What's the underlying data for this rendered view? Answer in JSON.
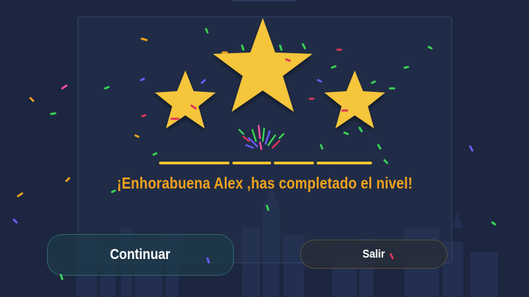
{
  "message": "¡Enhorabuena Alex ,has completado el nivel!",
  "buttons": {
    "continue_label": "Continuar",
    "exit_label": "Salir"
  },
  "rating": {
    "stars_earned": 3,
    "stars_total": 3,
    "progress_segments": 4
  },
  "colors": {
    "background": "#1c2640",
    "star": "#f5c53a",
    "message": "#f0a21e",
    "continue_border": "#2f6b6c",
    "exit_border": "#5a5142"
  },
  "icons": {
    "star": "star-icon"
  }
}
